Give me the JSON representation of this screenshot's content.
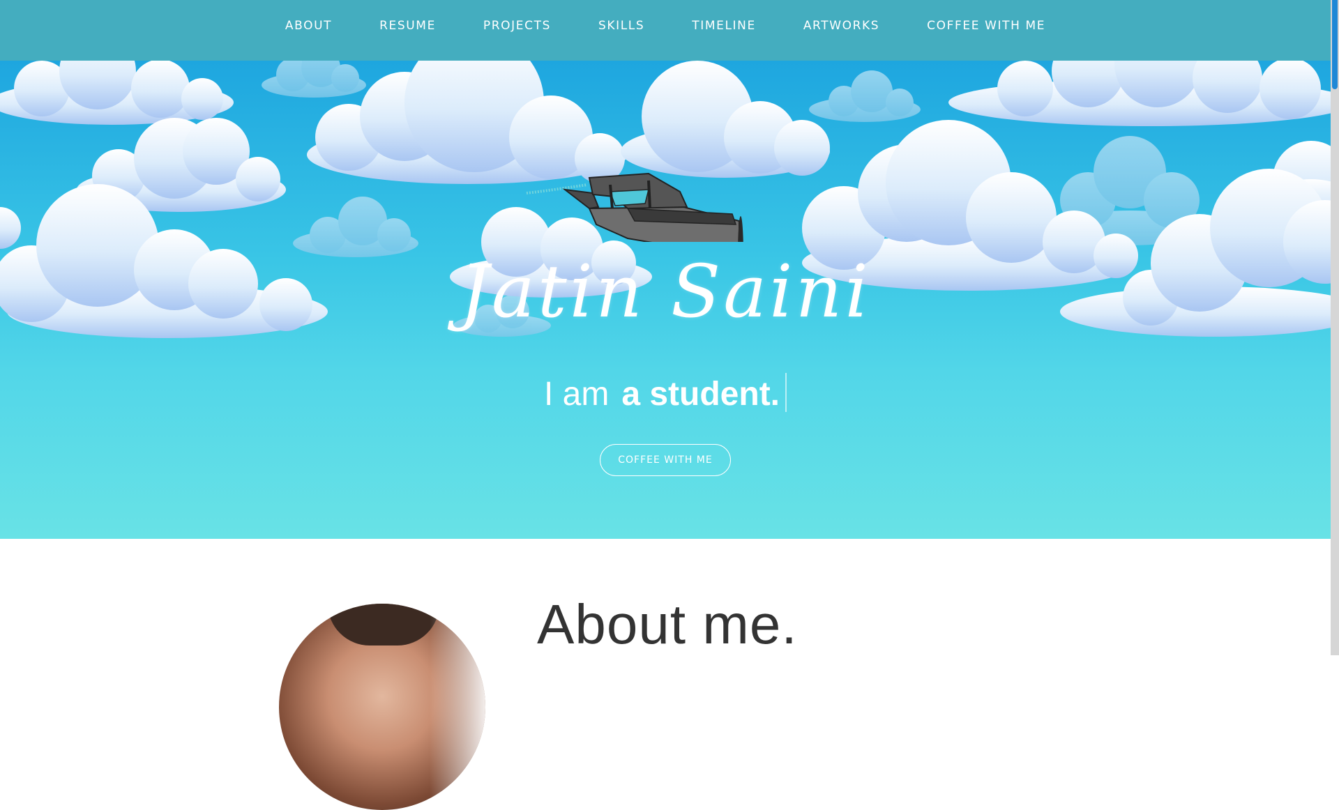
{
  "nav": {
    "items": [
      {
        "label": "ABOUT"
      },
      {
        "label": "RESUME"
      },
      {
        "label": "PROJECTS"
      },
      {
        "label": "SKILLS"
      },
      {
        "label": "TIMELINE"
      },
      {
        "label": "ARTWORKS"
      },
      {
        "label": "COFFEE WITH ME"
      }
    ]
  },
  "hero": {
    "name": "Jatin Saini",
    "tagline_prefix": "I am",
    "tagline_typed": "a student.",
    "button_label": "COFFEE WITH ME",
    "illustration": "airplane-in-clouds"
  },
  "about": {
    "title": "About me."
  },
  "colors": {
    "nav_bg": "#44adbf",
    "sky_top": "#1ea6df",
    "sky_bottom": "#68e2e6",
    "text_light": "#ffffff",
    "heading_dark": "#333333",
    "scroll_thumb": "#1e88d6"
  }
}
